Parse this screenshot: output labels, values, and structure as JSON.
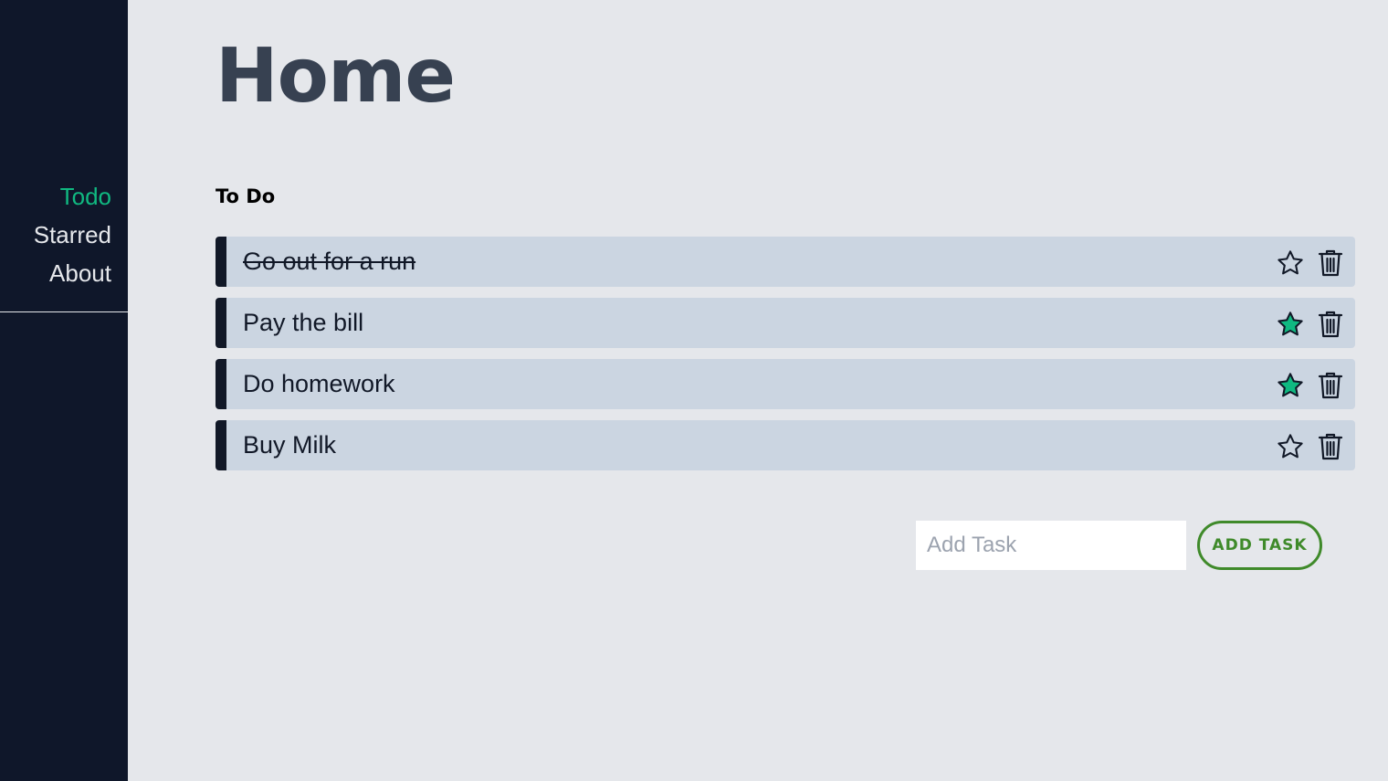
{
  "sidebar": {
    "items": [
      {
        "label": "Todo",
        "active": true
      },
      {
        "label": "Starred",
        "active": false
      },
      {
        "label": "About",
        "active": false
      }
    ]
  },
  "page": {
    "title": "Home",
    "section_title": "To Do"
  },
  "tasks": [
    {
      "text": "Go out for a run",
      "completed": true,
      "starred": false
    },
    {
      "text": "Pay the bill",
      "completed": false,
      "starred": true
    },
    {
      "text": "Do homework",
      "completed": false,
      "starred": true
    },
    {
      "text": "Buy Milk",
      "completed": false,
      "starred": false
    }
  ],
  "add_task": {
    "placeholder": "Add Task",
    "value": "",
    "button_label": "ADD TASK"
  },
  "colors": {
    "sidebar_bg": "#0f172a",
    "accent": "#10b981",
    "page_bg": "#e5e7eb",
    "task_bg": "#cbd5e1",
    "add_button": "#3f8a2a"
  },
  "icons": {
    "star": "star-icon",
    "delete": "trash-icon"
  }
}
